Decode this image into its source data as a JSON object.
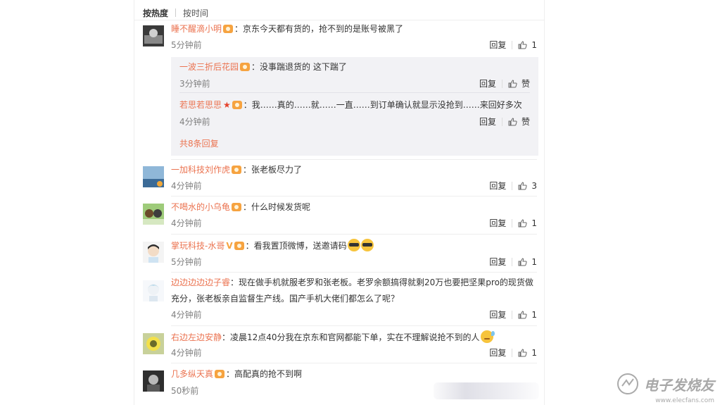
{
  "sort": {
    "hot": "按热度",
    "time": "按时间"
  },
  "comments": [
    {
      "user": "睡不醒滴小明",
      "text": "：京东今天都有货的，抢不到的是账号被黑了",
      "time": "5分钟前",
      "reply": "回复",
      "likes": "1",
      "replies": [
        {
          "user": "一波三折后花园",
          "text": "：没事踹退货的 这下踹了",
          "time": "3分钟前",
          "reply": "回复",
          "like": "赞"
        },
        {
          "user": "若思若思思",
          "text": "：我……真的……就……一直……到订单确认就显示没抢到……来回好多次",
          "time": "4分钟前",
          "reply": "回复",
          "like": "赞"
        }
      ],
      "more": "共8条回复"
    },
    {
      "user": "一加科技刘作虎",
      "text": "：张老板尽力了",
      "time": "4分钟前",
      "reply": "回复",
      "likes": "3"
    },
    {
      "user": "不喝水的小乌龟",
      "text": "：什么时候发货呢",
      "time": "4分钟前",
      "reply": "回复",
      "likes": "1"
    },
    {
      "user": "掌玩科技-水哥",
      "text": "：看我置顶微博，送邀请码",
      "time": "5分钟前",
      "reply": "回复",
      "likes": "1"
    },
    {
      "user": "边边边边边子睿",
      "text1": "：现在做手机就服老罗和张老板。老罗余额搞得就剩20万也要把坚果pro的现货做",
      "text2": "充分，张老板亲自监督生产线。国产手机大佬们都怎么了呢？",
      "time": "4分钟前",
      "reply": "回复",
      "likes": "1"
    },
    {
      "user": "右边左边安静",
      "text": "：凌晨12点40分我在京东和官网都能下单，实在不理解说抢不到的人",
      "time": "4分钟前",
      "reply": "回复",
      "likes": "1"
    },
    {
      "user": "几多纵天真",
      "text": "：高配真的抢不到啊",
      "time": "50秒前"
    }
  ],
  "watermark": {
    "text": "电子发烧友",
    "url": "www.elecfans.com"
  },
  "colors": {
    "username": "#eb7350",
    "time": "#808080",
    "reply_bg": "#f2f2f5"
  }
}
